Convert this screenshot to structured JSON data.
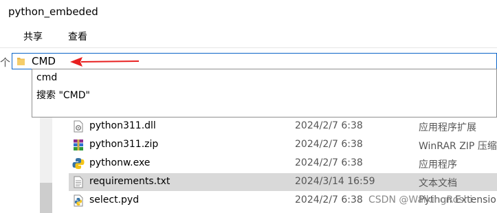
{
  "window": {
    "title": "python_embeded"
  },
  "ribbon": {
    "tabs": [
      {
        "label": "共享"
      },
      {
        "label": "查看"
      }
    ]
  },
  "nav": {
    "up_glyph": "个"
  },
  "address_bar": {
    "value": "CMD",
    "folder_icon": "folder-icon"
  },
  "annotation": {
    "arrow_color": "#e82020"
  },
  "autocomplete": {
    "items": [
      {
        "label": "cmd"
      },
      {
        "label": "搜索 \"CMD\""
      }
    ]
  },
  "files": [
    {
      "name": "python311.dll",
      "date": "2024/2/7 6:38",
      "type": "应用程序扩展",
      "icon": "dll-file-icon"
    },
    {
      "name": "python311.zip",
      "date": "2024/2/7 6:38",
      "type": "WinRAR ZIP 压缩",
      "icon": "winrar-archive-icon"
    },
    {
      "name": "pythonw.exe",
      "date": "2024/2/7 6:38",
      "type": "应用程序",
      "icon": "python-exe-icon"
    },
    {
      "name": "requirements.txt",
      "date": "2024/3/14 16:59",
      "type": "文本文档",
      "icon": "text-file-icon",
      "selected": true
    },
    {
      "name": "select.pyd",
      "date": "2024/2/7 6:38",
      "type": "Python Extensio",
      "icon": "python-pyd-icon"
    }
  ],
  "watermark": {
    "text": "CSDN @WalkingRoshi"
  },
  "colors": {
    "accent": "#0a64c8",
    "selection": "#d9d9d9"
  }
}
